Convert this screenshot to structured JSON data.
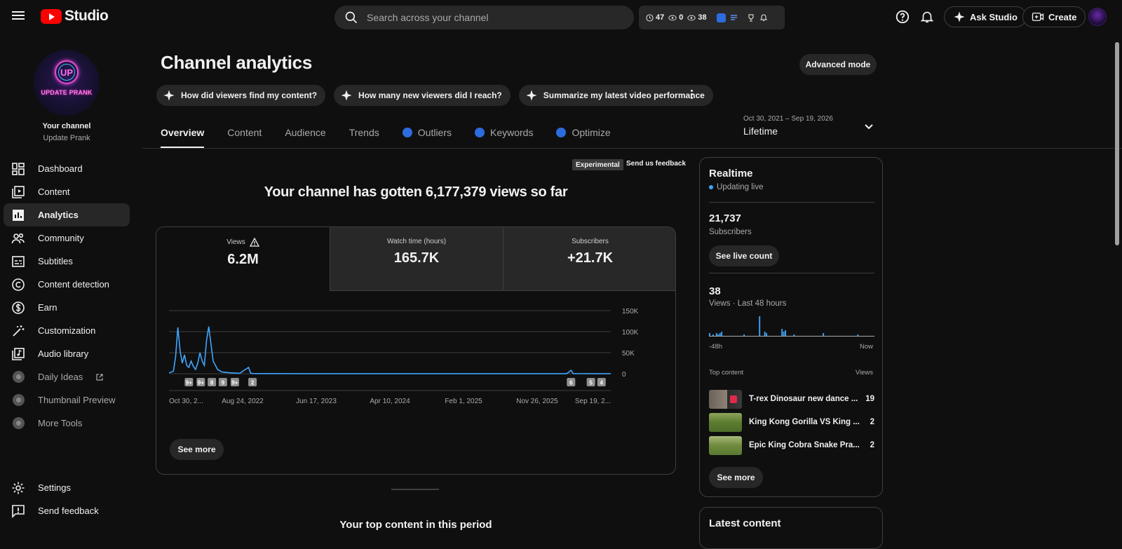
{
  "app": {
    "logo_text": "Studio"
  },
  "search": {
    "placeholder": "Search across your channel"
  },
  "header_stats": {
    "a": "47",
    "b": "0",
    "c": "38"
  },
  "header": {
    "ask_label": "Ask Studio",
    "create_label": "Create"
  },
  "sidebar": {
    "avatar_text": "UP",
    "avatar_name": "UPDATE PRANK",
    "your_channel": "Your channel",
    "channel_name": "Update Prank",
    "items": [
      {
        "label": "Dashboard",
        "icon": "dashboard-icon"
      },
      {
        "label": "Content",
        "icon": "content-icon"
      },
      {
        "label": "Analytics",
        "icon": "analytics-icon",
        "active": true
      },
      {
        "label": "Community",
        "icon": "community-icon"
      },
      {
        "label": "Subtitles",
        "icon": "subtitles-icon"
      },
      {
        "label": "Content detection",
        "icon": "copyright-icon"
      },
      {
        "label": "Earn",
        "icon": "dollar-icon"
      },
      {
        "label": "Customization",
        "icon": "magic-wand-icon"
      },
      {
        "label": "Audio library",
        "icon": "audio-library-icon"
      },
      {
        "label": "Daily Ideas",
        "icon": "extension-icon"
      },
      {
        "label": "Thumbnail Preview",
        "icon": "extension-icon"
      },
      {
        "label": "More Tools",
        "icon": "extension-icon"
      }
    ],
    "bottom": [
      {
        "label": "Settings",
        "icon": "settings-icon"
      },
      {
        "label": "Send feedback",
        "icon": "feedback-icon"
      }
    ]
  },
  "main": {
    "title": "Channel analytics",
    "advanced_mode": "Advanced mode",
    "chips": [
      "How did viewers find my content?",
      "How many new viewers did I reach?",
      "Summarize my latest video performance"
    ],
    "tabs": [
      {
        "label": "Overview",
        "active": true
      },
      {
        "label": "Content"
      },
      {
        "label": "Audience"
      },
      {
        "label": "Trends"
      },
      {
        "label": "Outliers",
        "ext": true
      },
      {
        "label": "Keywords",
        "ext": true
      },
      {
        "label": "Optimize",
        "ext": true
      }
    ],
    "date_range": {
      "dates": "Oct 30, 2021 – Sep 19, 2026",
      "label": "Lifetime"
    },
    "experimental": "Experimental",
    "send_feedback": "Send us feedback",
    "headline": "Your channel has gotten 6,177,379 views so far",
    "metrics": [
      {
        "label": "Views",
        "value": "6.2M",
        "selected": true,
        "warning": true
      },
      {
        "label": "Watch time (hours)",
        "value": "165.7K"
      },
      {
        "label": "Subscribers",
        "value": "+21.7K"
      }
    ],
    "see_more": "See more",
    "top_content_title": "Your top content in this period"
  },
  "chart_data": {
    "type": "line",
    "x_ticks": [
      "Oct 30, 2...",
      "Aug 24, 2022",
      "Jun 17, 2023",
      "Apr 10, 2024",
      "Feb 1, 2025",
      "Nov 26, 2025",
      "Sep 19, 2..."
    ],
    "y_ticks": [
      "150K",
      "100K",
      "50K",
      "0"
    ],
    "ylim": [
      0,
      150000
    ],
    "series": [
      {
        "values": [
          [
            0.0,
            2000
          ],
          [
            0.01,
            6000
          ],
          [
            0.015,
            40000
          ],
          [
            0.02,
            110000
          ],
          [
            0.025,
            55000
          ],
          [
            0.03,
            25000
          ],
          [
            0.035,
            45000
          ],
          [
            0.04,
            20000
          ],
          [
            0.045,
            15000
          ],
          [
            0.05,
            30000
          ],
          [
            0.055,
            18000
          ],
          [
            0.06,
            10000
          ],
          [
            0.065,
            25000
          ],
          [
            0.07,
            50000
          ],
          [
            0.075,
            30000
          ],
          [
            0.08,
            20000
          ],
          [
            0.085,
            80000
          ],
          [
            0.09,
            112000
          ],
          [
            0.095,
            70000
          ],
          [
            0.1,
            30000
          ],
          [
            0.11,
            10000
          ],
          [
            0.12,
            4000
          ],
          [
            0.14,
            2000
          ],
          [
            0.16,
            1000
          ],
          [
            0.18,
            15000
          ],
          [
            0.185,
            1000
          ],
          [
            0.19,
            500
          ],
          [
            0.2,
            300
          ],
          [
            0.3,
            200
          ],
          [
            0.5,
            150
          ],
          [
            0.7,
            150
          ],
          [
            0.9,
            200
          ],
          [
            0.91,
            8000
          ],
          [
            0.915,
            300
          ],
          [
            1.0,
            100
          ]
        ]
      }
    ],
    "markers": [
      {
        "x": 0.045,
        "label": "9+"
      },
      {
        "x": 0.072,
        "label": "9+"
      },
      {
        "x": 0.097,
        "label": "8"
      },
      {
        "x": 0.122,
        "label": "9"
      },
      {
        "x": 0.149,
        "label": "9+"
      },
      {
        "x": 0.189,
        "label": "2"
      },
      {
        "x": 0.91,
        "label": "6"
      },
      {
        "x": 0.955,
        "label": "5"
      },
      {
        "x": 0.979,
        "label": "4"
      }
    ]
  },
  "realtime": {
    "title": "Realtime",
    "live": "Updating live",
    "subs_value": "21,737",
    "subs_label": "Subscribers",
    "live_count_btn": "See live count",
    "views_value": "38",
    "views_label": "Views · Last 48 hours",
    "axis_left": "-48h",
    "axis_right": "Now",
    "top_content": "Top content",
    "views_hdr": "Views",
    "rows": [
      {
        "title": "T-rex Dinosaur new dance ...",
        "views": "19"
      },
      {
        "title": "King Kong Gorilla VS King ...",
        "views": "2"
      },
      {
        "title": "Epic King Cobra Snake Pra...",
        "views": "2"
      }
    ],
    "bars": [
      2,
      0,
      1,
      0,
      2,
      1,
      2,
      3,
      0,
      0,
      0,
      0,
      0,
      0,
      0,
      0,
      0,
      0,
      0,
      0,
      1,
      0,
      0,
      0,
      0,
      0,
      0,
      0,
      0,
      14,
      0,
      0,
      3,
      2,
      0,
      0,
      0,
      0,
      0,
      0,
      0,
      0,
      5,
      3,
      4,
      0,
      0,
      0,
      0,
      1,
      0,
      0,
      0,
      0,
      0,
      0,
      0,
      0,
      0,
      0,
      0,
      0,
      0,
      0,
      0,
      0,
      2,
      0,
      0,
      0,
      0,
      0,
      0,
      0,
      0,
      0,
      0,
      0,
      0,
      0,
      0,
      0,
      0,
      0,
      0,
      0,
      1,
      0,
      0,
      0,
      0,
      0,
      0,
      0,
      0,
      0
    ],
    "see_more": "See more",
    "latest": "Latest content"
  }
}
